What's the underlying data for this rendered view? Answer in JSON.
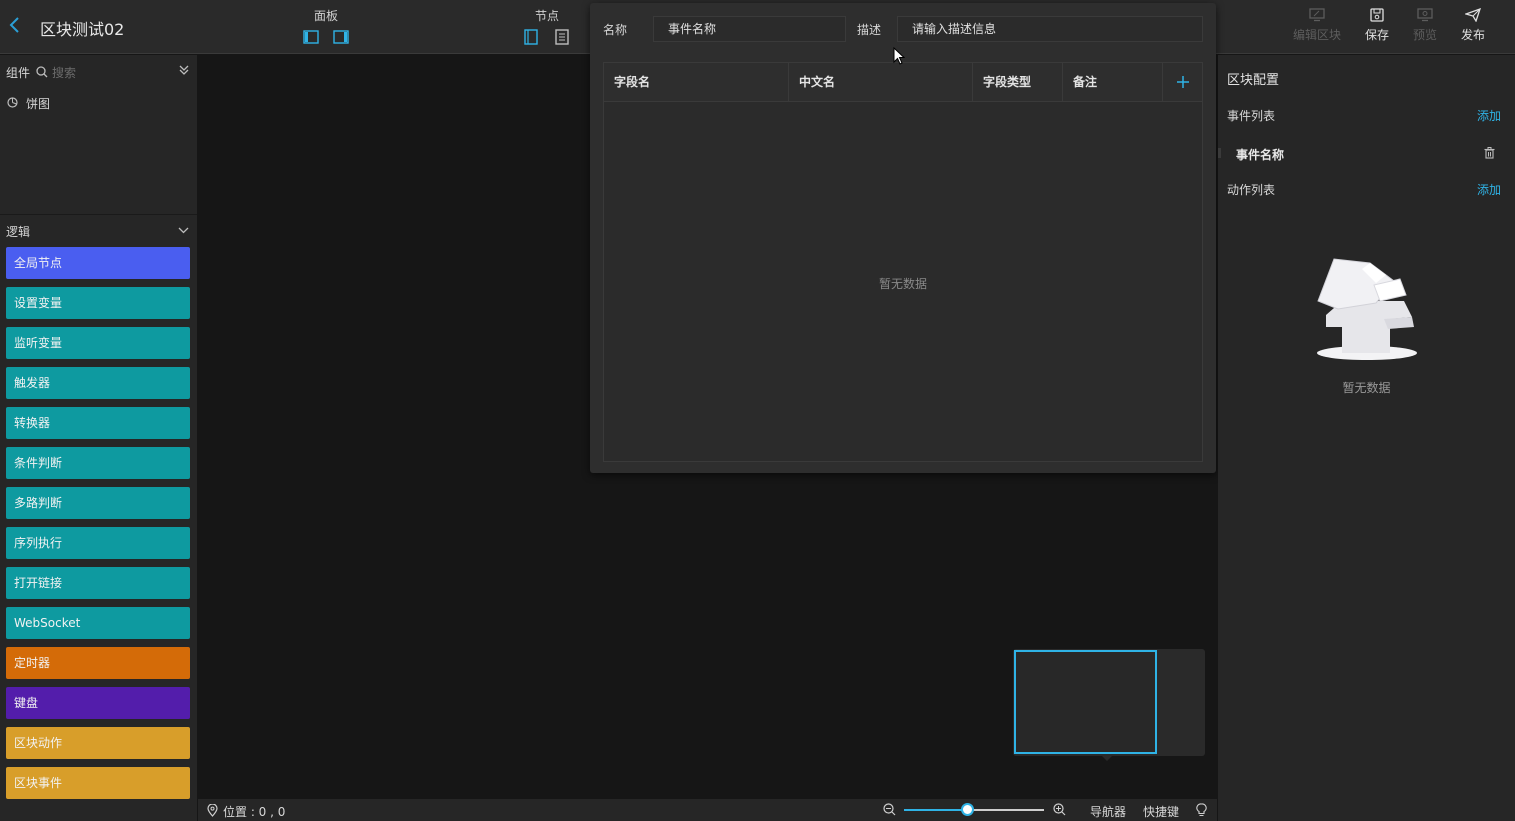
{
  "header": {
    "title": "区块测试02",
    "panel_group_label": "面板",
    "node_group_label": "节点",
    "actions": [
      {
        "label": "编辑区块",
        "icon": "monitor-edit-icon",
        "enabled": false
      },
      {
        "label": "保存",
        "icon": "save-icon",
        "enabled": true
      },
      {
        "label": "预览",
        "icon": "preview-icon",
        "enabled": false
      },
      {
        "label": "发布",
        "icon": "send-icon",
        "enabled": true
      }
    ]
  },
  "components": {
    "title": "组件",
    "search_placeholder": "搜索",
    "items": [
      {
        "label": "饼图",
        "icon": "pie-chart-icon"
      }
    ]
  },
  "logic": {
    "title": "逻辑",
    "nodes": [
      {
        "label": "全局节点",
        "color": "#4a5ef0"
      },
      {
        "label": "设置变量",
        "color": "#0e9aa0"
      },
      {
        "label": "监听变量",
        "color": "#0e9aa0"
      },
      {
        "label": "触发器",
        "color": "#0e9aa0"
      },
      {
        "label": "转换器",
        "color": "#0e9aa0"
      },
      {
        "label": "条件判断",
        "color": "#0e9aa0"
      },
      {
        "label": "多路判断",
        "color": "#0e9aa0"
      },
      {
        "label": "序列执行",
        "color": "#0e9aa0"
      },
      {
        "label": "打开链接",
        "color": "#0e9aa0"
      },
      {
        "label": "WebSocket",
        "color": "#0e9aa0"
      },
      {
        "label": "定时器",
        "color": "#d46b08"
      },
      {
        "label": "键盘",
        "color": "#531dab"
      },
      {
        "label": "区块动作",
        "color": "#d89e2a"
      },
      {
        "label": "区块事件",
        "color": "#d89e2a"
      }
    ]
  },
  "event_editor": {
    "name_label": "名称",
    "name_value": "事件名称",
    "desc_label": "描述",
    "desc_placeholder": "请输入描述信息",
    "columns": [
      "字段名",
      "中文名",
      "字段类型",
      "备注"
    ],
    "empty_text": "暂无数据"
  },
  "right_panel": {
    "title": "区块配置",
    "event_list_label": "事件列表",
    "event_add_label": "添加",
    "events": [
      "事件名称"
    ],
    "action_list_label": "动作列表",
    "action_add_label": "添加",
    "empty_text": "暂无数据"
  },
  "footer": {
    "position_label": "位置 : 0 , 0",
    "zoom_level": 0.45,
    "navigator_label": "导航器",
    "shortcut_label": "快捷键"
  }
}
